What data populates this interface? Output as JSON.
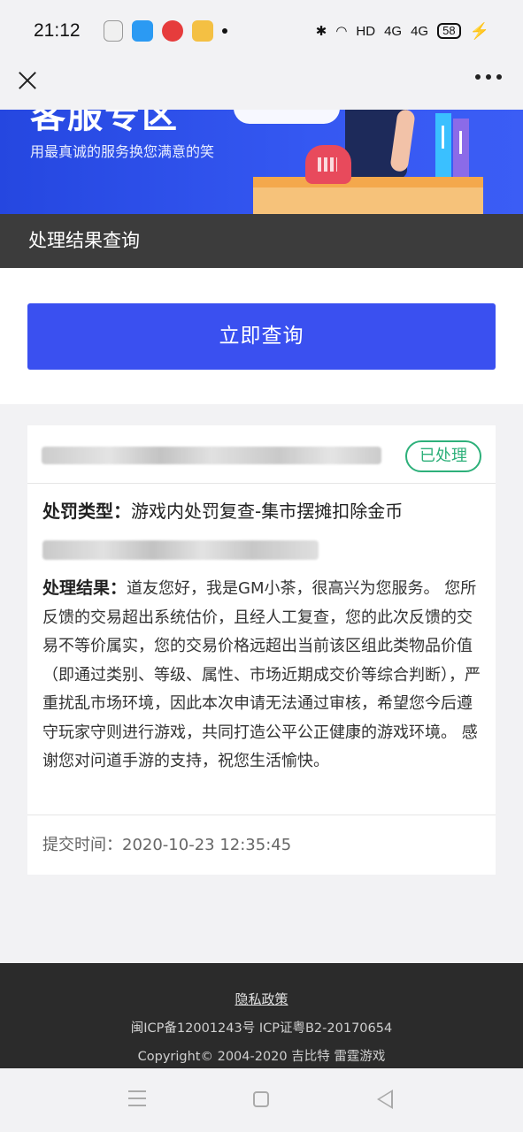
{
  "status_bar": {
    "time": "21:12",
    "indicators": [
      "bluetooth-icon",
      "wifi-icon",
      "HD",
      "4G",
      "4G"
    ],
    "hd_label": "HD",
    "net1": "4G",
    "net2": "4G",
    "battery": "58"
  },
  "banner": {
    "title": "客服专区",
    "subtitle": "用最真诚的服务换您满意的笑"
  },
  "section": {
    "title": "处理结果查询"
  },
  "query": {
    "button_label": "立即查询"
  },
  "record": {
    "status_badge": "已处理",
    "penalty_label": "处罚类型：",
    "penalty_value": "游戏内处罚复查-集市摆摊扣除金币",
    "result_label": "处理结果：",
    "result_text": "道友您好，我是GM小茶，很高兴为您服务。 您所反馈的交易超出系统估价，且经人工复查，您的此次反馈的交易不等价属实，您的交易价格远超出当前该区组此类物品价值（即通过类别、等级、属性、市场近期成交价等综合判断），严重扰乱市场环境，因此本次申请无法通过审核，希望您今后遵守玩家守则进行游戏，共同打造公平公正健康的游戏环境。 感谢您对问道手游的支持，祝您生活愉快。",
    "submit_label": "提交时间：",
    "submit_time": "2020-10-23 12:35:45"
  },
  "footer": {
    "privacy": "隐私政策",
    "icp": "闽ICP备12001243号   ICP证粤B2-20170654",
    "copyright": "Copyright© 2004-2020  吉比特  雷霆游戏"
  },
  "colors": {
    "primary_button": "#3a50f0",
    "section_bar": "#3c3c3c",
    "badge_green": "#2db07a",
    "footer_bg": "#2b2b2b"
  }
}
